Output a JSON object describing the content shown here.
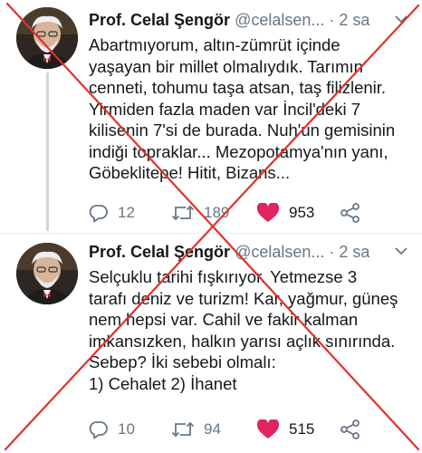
{
  "tweets": [
    {
      "author_name": "Prof. Celal Şengör",
      "author_handle": "@celalsen...",
      "separator": "·",
      "time": "2 sa",
      "text": "Abartmıyorum, altın-zümrüt içinde\nyaşayan bir millet olmalıydık. Tarımın\ncenneti, tohumu taşa atsan, taş filizlenir.\nYirmiden fazla maden var İncil'deki 7\nkilisenin 7'si de burada. Nuh'un gemisinin\nindiği topraklar... Mezopotamya'nın yanı,\nGöbeklitepe! Hitit, Bizans...",
      "replies": "12",
      "retweets": "189",
      "likes": "953"
    },
    {
      "author_name": "Prof. Celal Şengör",
      "author_handle": "@celalsen...",
      "separator": "·",
      "time": "2 sa",
      "text": "Selçuklu tarihi fışkırıyor. Yetmezse 3\ntarafı deniz ve turizm! Kar, yağmur, güneş\nnem hepsi var. Cahil ve fakir kalman\nimkansızken, halkın yarısı açlık sınırında.\nSebep? İki sebebi olmalı:\n1) Cehalet 2) İhanet",
      "replies": "10",
      "retweets": "94",
      "likes": "515"
    }
  ],
  "icons": [
    "avatar",
    "chevron-down-icon",
    "reply-icon",
    "retweet-icon",
    "heart-icon",
    "share-icon"
  ],
  "colors": {
    "text": "#14171a",
    "secondary": "#657786",
    "like": "#e0245e",
    "cross": "#e0322c",
    "thread_line": "#ccd6dd"
  }
}
